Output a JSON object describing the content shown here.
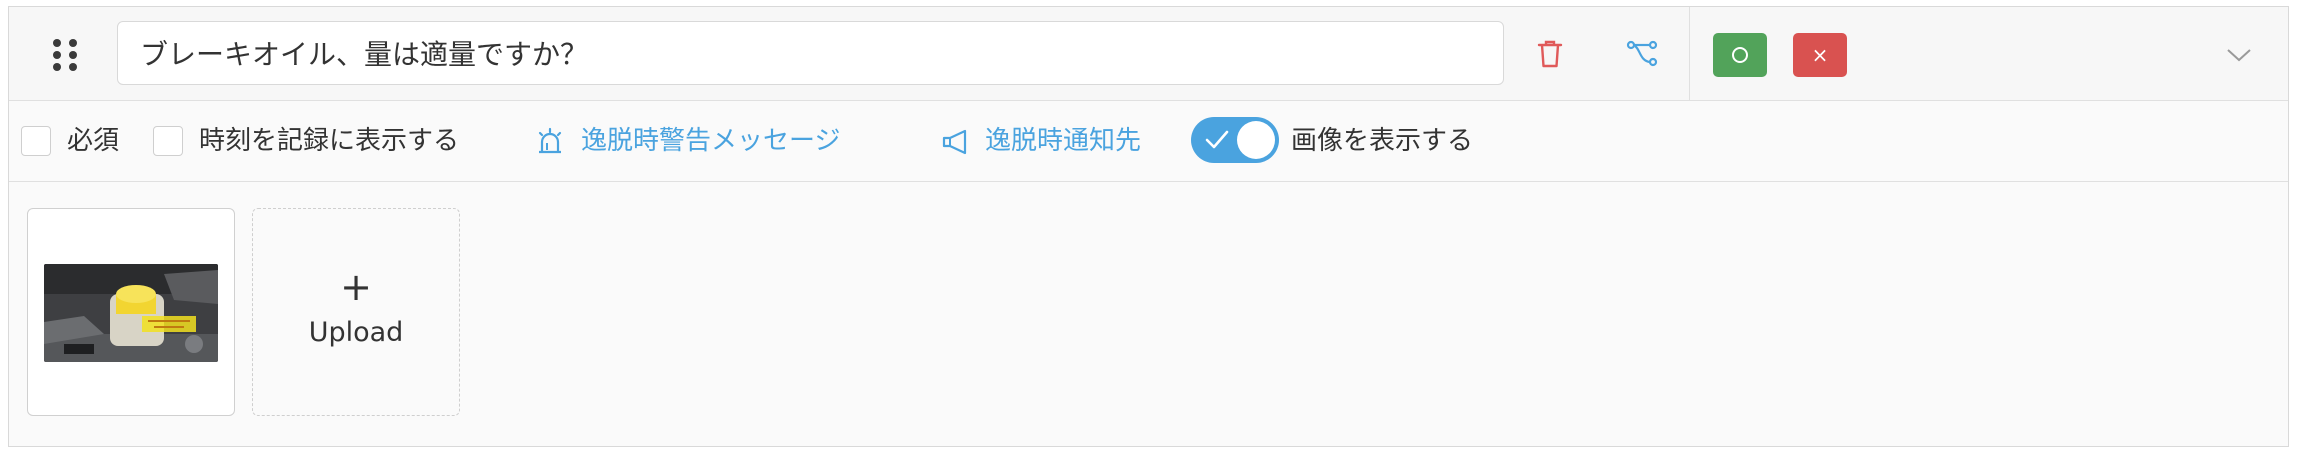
{
  "question": {
    "value": "ブレーキオイル、量は適量ですか？"
  },
  "answers": {
    "ok_symbol": "○",
    "ng_symbol": "×",
    "ok_color": "#52a35a",
    "ng_color": "#d95250"
  },
  "options": {
    "required_label": "必須",
    "record_time_label": "時刻を記録に表示する",
    "warning_message_label": "逸脱時警告メッセージ",
    "notify_label": "逸脱時通知先",
    "show_image_label": "画像を表示する",
    "show_image_on": true
  },
  "images": {
    "upload_plus": "+",
    "upload_label": "Upload"
  },
  "colors": {
    "accent": "#4aa3df",
    "delete": "#e05a5a"
  },
  "icons": [
    "drag-handle-icon",
    "trash-icon",
    "branch-icon",
    "chevron-down-icon",
    "alarm-icon",
    "megaphone-icon",
    "check-icon"
  ]
}
